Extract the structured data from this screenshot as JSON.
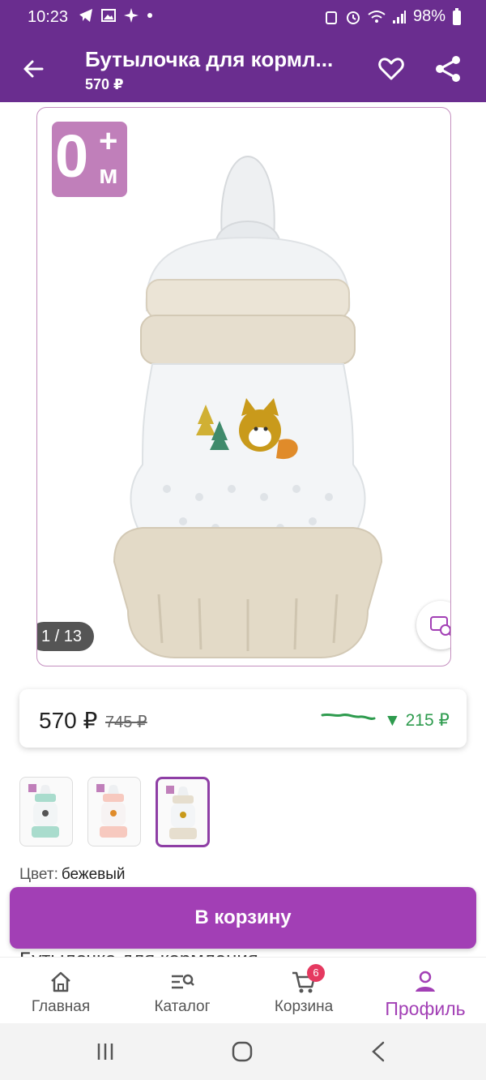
{
  "status_bar": {
    "time": "10:23",
    "battery": "98%"
  },
  "app_bar": {
    "title": "Бутылочка для кормл...",
    "price": "570 ₽"
  },
  "gallery": {
    "age_badge_number": "0",
    "age_badge_plus": "+",
    "age_badge_unit": "м",
    "counter": "1 / 13"
  },
  "price_card": {
    "price": "570 ₽",
    "old_price": "745 ₽",
    "drop": "▼ 215 ₽"
  },
  "color": {
    "label": "Цвет:",
    "value": "бежевый"
  },
  "cart_button": {
    "label": "В корзину"
  },
  "product_title_peek": "Бутылочка для кормления",
  "bottom_nav": {
    "items": [
      {
        "label": "Главная",
        "icon": "home-icon"
      },
      {
        "label": "Каталог",
        "icon": "catalog-search-icon"
      },
      {
        "label": "Корзина",
        "icon": "cart-icon",
        "badge": "6"
      },
      {
        "label": "Профиль",
        "icon": "profile-icon"
      }
    ]
  },
  "colors": {
    "primary": "#6a2d8f",
    "accent": "#a23fb5",
    "badge": "#c07fba",
    "price_drop": "#2e9b4e"
  }
}
